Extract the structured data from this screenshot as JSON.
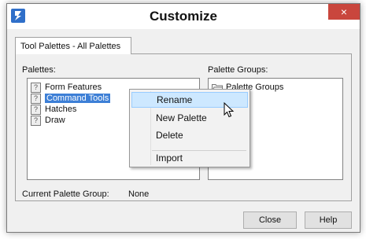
{
  "window": {
    "title": "Customize",
    "close_glyph": "×"
  },
  "tabs": [
    {
      "label": "Tool Palettes - All Palettes"
    }
  ],
  "palettes": {
    "label": "Palettes:",
    "items": [
      {
        "label": "Form Features",
        "icon": "question-mark-icon",
        "selected": false
      },
      {
        "label": "Command Tools",
        "icon": "question-mark-icon",
        "selected": true
      },
      {
        "label": "Hatches",
        "icon": "question-mark-icon",
        "selected": false
      },
      {
        "label": "Draw",
        "icon": "question-mark-icon",
        "selected": false
      }
    ]
  },
  "palette_groups": {
    "label": "Palette Groups:",
    "items": [
      {
        "label": "Palette Groups",
        "icon": "folder-icon"
      }
    ]
  },
  "context_menu": {
    "items": [
      {
        "label": "Rename",
        "hover": true
      },
      {
        "label": "New Palette"
      },
      {
        "label": "Delete"
      },
      {
        "label": "Import"
      }
    ]
  },
  "current_group": {
    "label": "Current Palette Group:",
    "value": "None"
  },
  "buttons": {
    "close": "Close",
    "help": "Help"
  },
  "colors": {
    "selection": "#3d7fd6",
    "close_button": "#c9463d",
    "menu_hover": "#cde8ff"
  }
}
